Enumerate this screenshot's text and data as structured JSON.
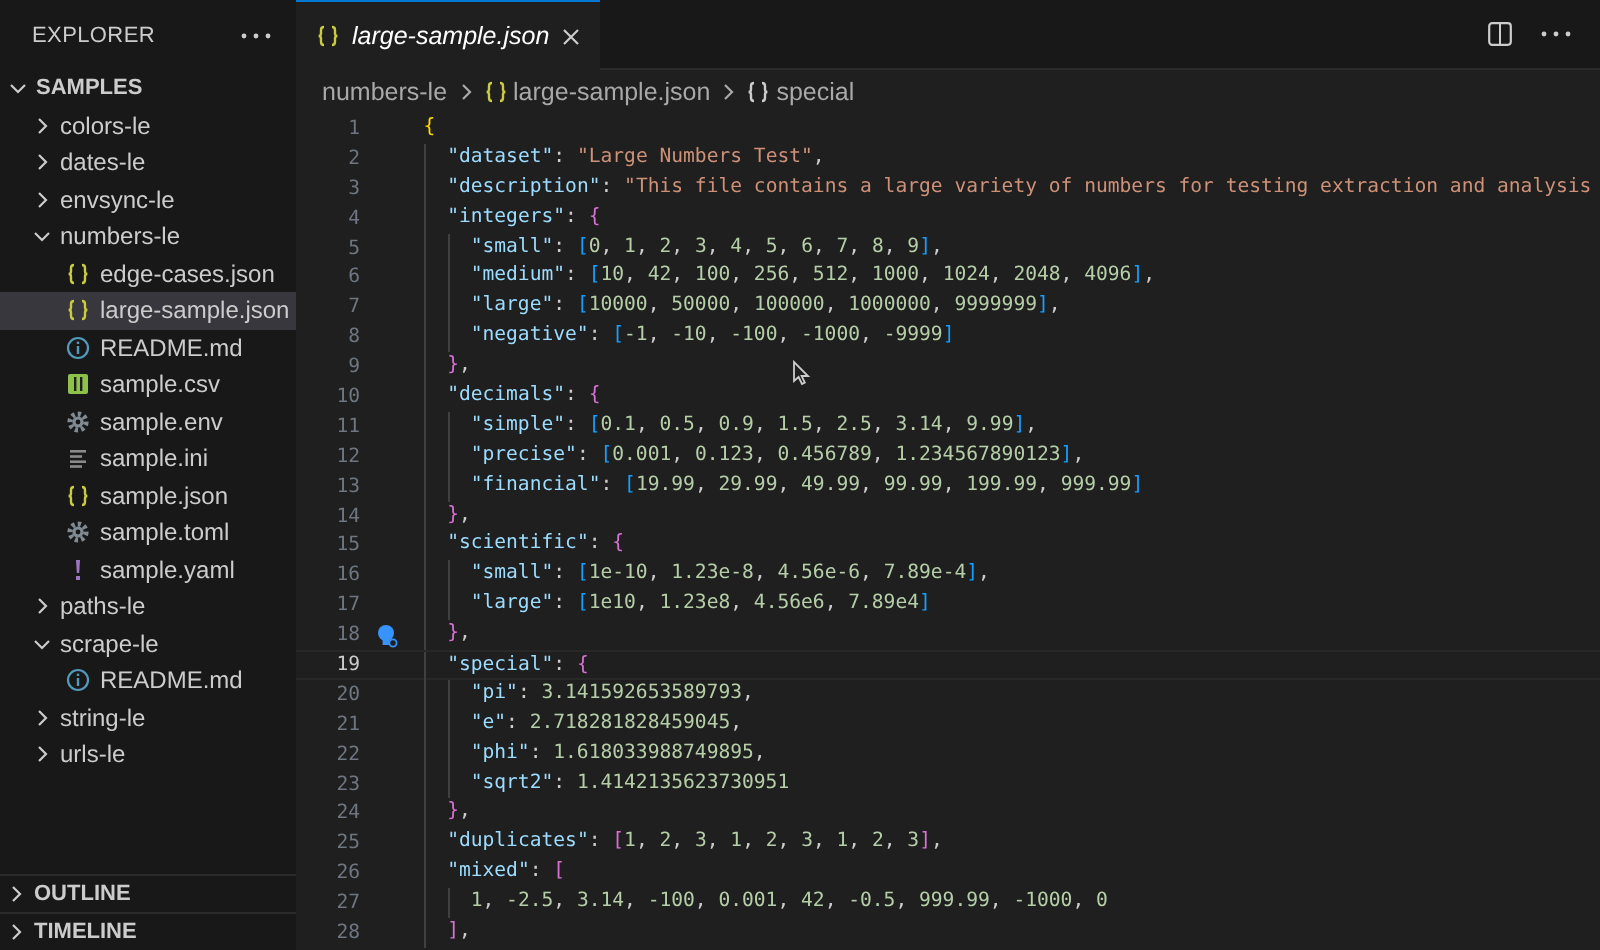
{
  "sidebar": {
    "title": "EXPLORER",
    "tree": {
      "label": "SAMPLES",
      "kind": "folder",
      "expanded": true,
      "selected": false,
      "children": [
        {
          "label": "colors-le",
          "kind": "folder",
          "expanded": false,
          "selected": false
        },
        {
          "label": "dates-le",
          "kind": "folder",
          "expanded": false,
          "selected": false
        },
        {
          "label": "envsync-le",
          "kind": "folder",
          "expanded": false,
          "selected": false
        },
        {
          "label": "numbers-le",
          "kind": "folder",
          "expanded": true,
          "selected": false,
          "children": [
            {
              "label": "edge-cases.json",
              "kind": "json",
              "selected": false
            },
            {
              "label": "large-sample.json",
              "kind": "json",
              "selected": true
            },
            {
              "label": "README.md",
              "kind": "info",
              "selected": false
            },
            {
              "label": "sample.csv",
              "kind": "csv",
              "selected": false
            },
            {
              "label": "sample.env",
              "kind": "gear",
              "selected": false
            },
            {
              "label": "sample.ini",
              "kind": "lines",
              "selected": false
            },
            {
              "label": "sample.json",
              "kind": "json",
              "selected": false
            },
            {
              "label": "sample.toml",
              "kind": "gear",
              "selected": false
            },
            {
              "label": "sample.yaml",
              "kind": "yaml",
              "selected": false
            }
          ]
        },
        {
          "label": "paths-le",
          "kind": "folder",
          "expanded": false,
          "selected": false
        },
        {
          "label": "scrape-le",
          "kind": "folder",
          "expanded": true,
          "selected": false,
          "children": [
            {
              "label": "README.md",
              "kind": "info",
              "selected": false
            }
          ]
        },
        {
          "label": "string-le",
          "kind": "folder",
          "expanded": false,
          "selected": false
        },
        {
          "label": "urls-le",
          "kind": "folder",
          "expanded": false,
          "selected": false
        }
      ]
    },
    "sections": [
      {
        "label": "OUTLINE",
        "expanded": false
      },
      {
        "label": "TIMELINE",
        "expanded": false
      }
    ]
  },
  "tabs": [
    {
      "label": "large-sample.json",
      "selected": true,
      "preview": true
    }
  ],
  "breadcrumbs": [
    {
      "label": "numbers-le",
      "kind": "folder"
    },
    {
      "label": "large-sample.json",
      "kind": "json"
    },
    {
      "label": "special",
      "kind": "object"
    }
  ],
  "lines": [
    {
      "number": "1",
      "text": "{",
      "current": false,
      "lightbulb": false
    },
    {
      "number": "2",
      "text": "\"dataset\": \"Large Numbers Test\",",
      "current": false,
      "lightbulb": false
    },
    {
      "number": "3",
      "text": "\"description\": \"This file contains a large variety of numbers for testing extraction and analysis",
      "current": false,
      "lightbulb": false
    },
    {
      "number": "4",
      "text": "\"integers\": {",
      "current": false,
      "lightbulb": false
    },
    {
      "number": "5",
      "text": "\"small\": [0, 1, 2, 3, 4, 5, 6, 7, 8, 9],",
      "current": false,
      "lightbulb": false
    },
    {
      "number": "6",
      "text": "\"medium\": [10, 42, 100, 256, 512, 1000, 1024, 2048, 4096],",
      "current": false,
      "lightbulb": false
    },
    {
      "number": "7",
      "text": "\"large\": [10000, 50000, 100000, 1000000, 9999999],",
      "current": false,
      "lightbulb": false
    },
    {
      "number": "8",
      "text": "\"negative\": [-1, -10, -100, -1000, -9999]",
      "current": false,
      "lightbulb": false
    },
    {
      "number": "9",
      "text": "},",
      "current": false,
      "lightbulb": false
    },
    {
      "number": "10",
      "text": "\"decimals\": {",
      "current": false,
      "lightbulb": false
    },
    {
      "number": "11",
      "text": "\"simple\": [0.1, 0.5, 0.9, 1.5, 2.5, 3.14, 9.99],",
      "current": false,
      "lightbulb": false
    },
    {
      "number": "12",
      "text": "\"precise\": [0.001, 0.123, 0.456789, 1.234567890123],",
      "current": false,
      "lightbulb": false
    },
    {
      "number": "13",
      "text": "\"financial\": [19.99, 29.99, 49.99, 99.99, 199.99, 999.99]",
      "current": false,
      "lightbulb": false
    },
    {
      "number": "14",
      "text": "},",
      "current": false,
      "lightbulb": false
    },
    {
      "number": "15",
      "text": "\"scientific\": {",
      "current": false,
      "lightbulb": false
    },
    {
      "number": "16",
      "text": "\"small\": [1e-10, 1.23e-8, 4.56e-6, 7.89e-4],",
      "current": false,
      "lightbulb": false
    },
    {
      "number": "17",
      "text": "\"large\": [1e10, 1.23e8, 4.56e6, 7.89e4]",
      "current": false,
      "lightbulb": false
    },
    {
      "number": "18",
      "text": "},",
      "current": false,
      "lightbulb": true
    },
    {
      "number": "19",
      "text": "\"special\": {",
      "current": true,
      "lightbulb": false
    },
    {
      "number": "20",
      "text": "\"pi\": 3.141592653589793,",
      "current": false,
      "lightbulb": false
    },
    {
      "number": "21",
      "text": "\"e\": 2.718281828459045,",
      "current": false,
      "lightbulb": false
    },
    {
      "number": "22",
      "text": "\"phi\": 1.618033988749895,",
      "current": false,
      "lightbulb": false
    },
    {
      "number": "23",
      "text": "\"sqrt2\": 1.4142135623730951",
      "current": false,
      "lightbulb": false
    },
    {
      "number": "24",
      "text": "},",
      "current": false,
      "lightbulb": false
    },
    {
      "number": "25",
      "text": "\"duplicates\": [1, 2, 3, 1, 2, 3, 1, 2, 3],",
      "current": false,
      "lightbulb": false
    },
    {
      "number": "26",
      "text": "\"mixed\": [",
      "current": false,
      "lightbulb": false
    },
    {
      "number": "27",
      "text": "1, -2.5, 3.14, -100, 0.001, 42, -0.5, 999.99, -1000, 0",
      "current": false,
      "lightbulb": false
    },
    {
      "number": "28",
      "text": "],",
      "current": false,
      "lightbulb": false
    }
  ]
}
